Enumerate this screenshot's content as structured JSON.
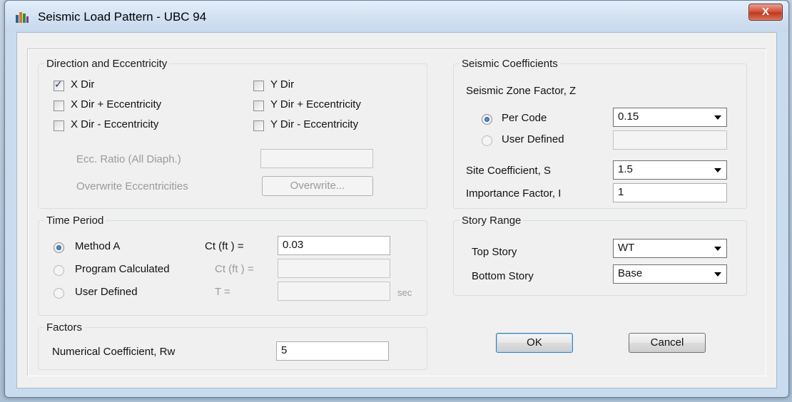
{
  "window": {
    "title": "Seismic Load Pattern - UBC 94",
    "close_label": "X"
  },
  "direction": {
    "legend": "Direction and Eccentricity",
    "x_dir": {
      "label": "X Dir",
      "checked": true
    },
    "x_dir_plus": {
      "label": "X Dir + Eccentricity",
      "checked": false
    },
    "x_dir_minus": {
      "label": "X Dir - Eccentricity",
      "checked": false
    },
    "y_dir": {
      "label": "Y Dir",
      "checked": false
    },
    "y_dir_plus": {
      "label": "Y Dir + Eccentricity",
      "checked": false
    },
    "y_dir_minus": {
      "label": "Y Dir - Eccentricity",
      "checked": false
    },
    "ecc_ratio_label": "Ecc. Ratio (All Diaph.)",
    "ecc_ratio_value": "",
    "overwrite_label": "Overwrite Eccentricities",
    "overwrite_button": "Overwrite..."
  },
  "time_period": {
    "legend": "Time Period",
    "method_a": {
      "label": "Method A",
      "selected": true
    },
    "program_calculated": {
      "label": "Program Calculated",
      "selected": false
    },
    "user_defined": {
      "label": "User Defined",
      "selected": false
    },
    "ct_label_1": "Ct (ft ) =",
    "ct_value_1": "0.03",
    "ct_label_2": "Ct (ft ) =",
    "ct_value_2": "",
    "t_label": "T =",
    "t_value": "",
    "t_unit": "sec"
  },
  "factors": {
    "legend": "Factors",
    "rw_label": "Numerical Coefficient, Rw",
    "rw_value": "5"
  },
  "seismic": {
    "legend": "Seismic Coefficients",
    "zone_label": "Seismic Zone Factor, Z",
    "per_code": {
      "label": "Per Code",
      "selected": true
    },
    "user_defined": {
      "label": "User Defined",
      "selected": false
    },
    "zone_value": "0.15",
    "user_value": "",
    "site_label": "Site Coefficient, S",
    "site_value": "1.5",
    "importance_label": "Importance Factor, I",
    "importance_value": "1"
  },
  "story_range": {
    "legend": "Story Range",
    "top_label": "Top Story",
    "top_value": "WT",
    "bottom_label": "Bottom Story",
    "bottom_value": "Base"
  },
  "buttons": {
    "ok": "OK",
    "cancel": "Cancel"
  },
  "colors": {
    "title_bar": "#d3e2f2",
    "close_button": "#c0381f",
    "client_bg": "#f0f0f0",
    "disabled_text": "#9a9a9a"
  }
}
